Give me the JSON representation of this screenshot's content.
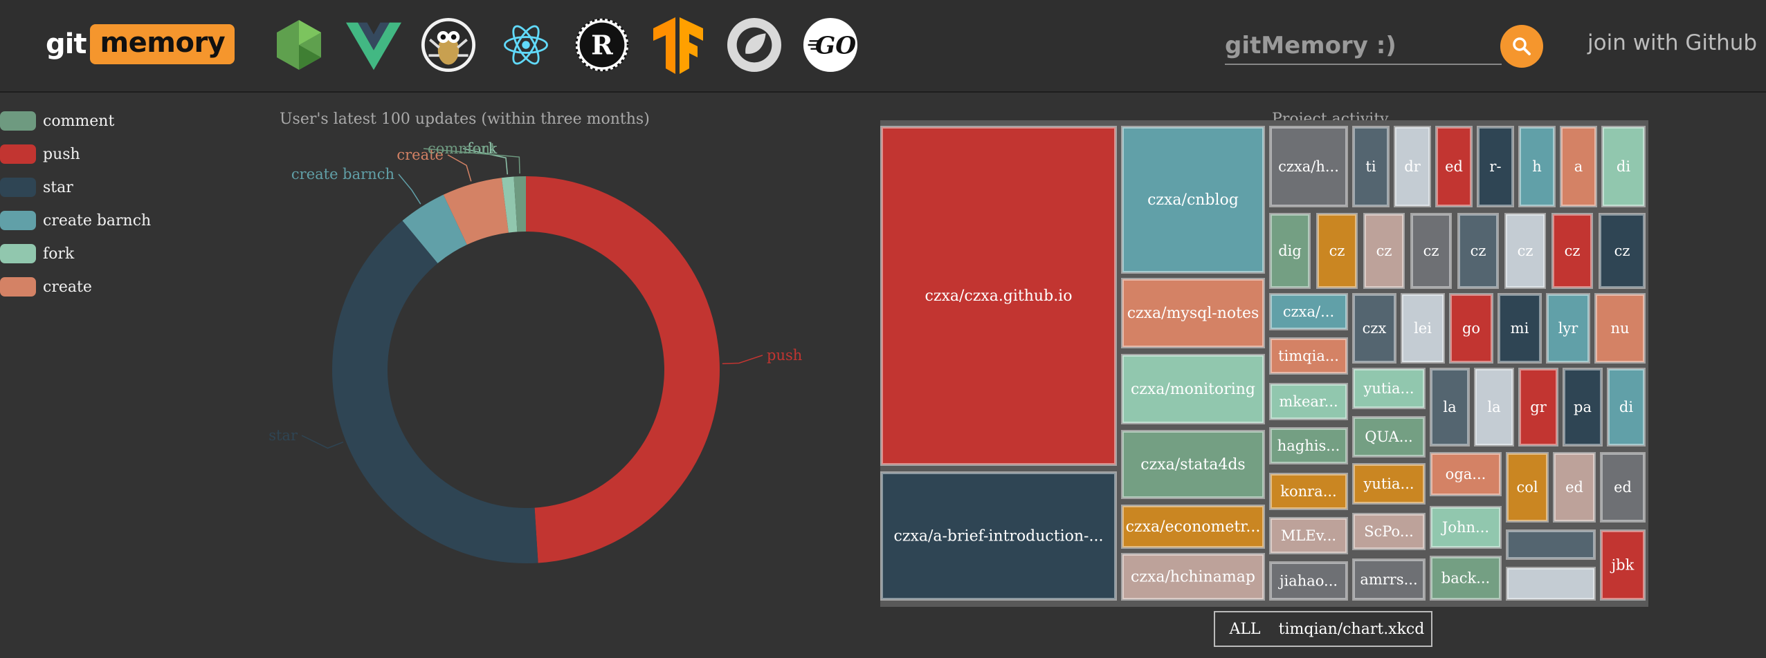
{
  "header": {
    "logo": {
      "part1": "git",
      "part2": "memory"
    },
    "tech_icons": [
      {
        "name": "nodejs-icon",
        "color": "#5fa04e"
      },
      {
        "name": "vue-icon",
        "color": "#42b883"
      },
      {
        "name": "scrapy-spider-icon",
        "color": "#c8a050"
      },
      {
        "name": "react-icon",
        "color": "#61dafb"
      },
      {
        "name": "rust-icon",
        "color": "#111111"
      },
      {
        "name": "tensorflow-icon",
        "color": "#ff8f00"
      },
      {
        "name": "spring-icon",
        "color": "#dddddd"
      },
      {
        "name": "golang-icon",
        "text": "GO"
      }
    ],
    "search": {
      "placeholder": "gitMemory :)"
    },
    "search_icon": "search-icon",
    "join_label": "join with Github"
  },
  "legend": [
    {
      "label": "comment",
      "color": "#6e9a80"
    },
    {
      "label": "push",
      "color": "#c23531"
    },
    {
      "label": "star",
      "color": "#2f4554"
    },
    {
      "label": "create barnch",
      "color": "#61a0a8"
    },
    {
      "label": "fork",
      "color": "#91c7ae"
    },
    {
      "label": "create",
      "color": "#d48265"
    }
  ],
  "chart_data": [
    {
      "type": "pie",
      "title": "User's latest 100 updates (within three months)",
      "slices": [
        {
          "name": "push",
          "value": 49,
          "color": "#c23531"
        },
        {
          "name": "star",
          "value": 40,
          "color": "#2f4554"
        },
        {
          "name": "create barnch",
          "value": 4,
          "color": "#61a0a8"
        },
        {
          "name": "create",
          "value": 5,
          "color": "#d48265"
        },
        {
          "name": "fork",
          "value": 1,
          "color": "#91c7ae"
        },
        {
          "name": "comment",
          "value": 1,
          "color": "#6e9a80"
        }
      ],
      "callouts": [
        {
          "name": "push",
          "label": "push"
        },
        {
          "name": "star",
          "label": "star"
        },
        {
          "name": "create barnch",
          "label": "create barnch"
        },
        {
          "name": "create",
          "label": "create"
        },
        {
          "name": "fork",
          "label": "fork"
        },
        {
          "name": "comment",
          "label": "comment"
        }
      ]
    },
    {
      "type": "treemap",
      "title": "Project activity",
      "nodes": [
        {
          "label": "czxa/czxa.github.io",
          "color": "#c23531"
        },
        {
          "label": "czxa/a-brief-introduction-...",
          "color": "#2f4554"
        },
        {
          "label": "czxa/cnblog",
          "color": "#61a0a8"
        },
        {
          "label": "czxa/mysql-notes",
          "color": "#d48265"
        },
        {
          "label": "czxa/monitoring",
          "color": "#91c7ae"
        },
        {
          "label": "czxa/stata4ds",
          "color": "#749f83"
        },
        {
          "label": "czxa/econometr...",
          "color": "#ca8622"
        },
        {
          "label": "czxa/hchinamap",
          "color": "#bda29a"
        },
        {
          "label": "czxa/h...",
          "color": "#6e7074"
        },
        {
          "label": "ti",
          "color": "#546570"
        },
        {
          "label": "dr",
          "color": "#c4ccd3"
        },
        {
          "label": "ed",
          "color": "#c23531"
        },
        {
          "label": "r-",
          "color": "#2f4554"
        },
        {
          "label": "h",
          "color": "#61a0a8"
        },
        {
          "label": "a",
          "color": "#d48265"
        },
        {
          "label": "di",
          "color": "#91c7ae"
        },
        {
          "label": "dig",
          "color": "#749f83"
        },
        {
          "label": "cz",
          "color": "#ca8622"
        },
        {
          "label": "cz",
          "color": "#bda29a"
        },
        {
          "label": "cz",
          "color": "#6e7074"
        },
        {
          "label": "cz",
          "color": "#546570"
        },
        {
          "label": "cz",
          "color": "#c4ccd3"
        },
        {
          "label": "cz",
          "color": "#c23531"
        },
        {
          "label": "cz",
          "color": "#2f4554"
        },
        {
          "label": "czxa/...",
          "color": "#61a0a8"
        },
        {
          "label": "timqia...",
          "color": "#d48265"
        },
        {
          "label": "mkear...",
          "color": "#91c7ae"
        },
        {
          "label": "haghis...",
          "color": "#749f83"
        },
        {
          "label": "konra...",
          "color": "#ca8622"
        },
        {
          "label": "MLEv...",
          "color": "#bda29a"
        },
        {
          "label": "jiahao...",
          "color": "#6e7074"
        },
        {
          "label": "czx",
          "color": "#546570"
        },
        {
          "label": "lei",
          "color": "#c4ccd3"
        },
        {
          "label": "go",
          "color": "#c23531"
        },
        {
          "label": "mi",
          "color": "#2f4554"
        },
        {
          "label": "lyr",
          "color": "#61a0a8"
        },
        {
          "label": "nu",
          "color": "#d48265"
        },
        {
          "label": "yutia...",
          "color": "#91c7ae"
        },
        {
          "label": "QUA...",
          "color": "#749f83"
        },
        {
          "label": "yutia...",
          "color": "#ca8622"
        },
        {
          "label": "ScPo...",
          "color": "#bda29a"
        },
        {
          "label": "amrrs...",
          "color": "#6e7074"
        },
        {
          "label": "la",
          "color": "#546570"
        },
        {
          "label": "la",
          "color": "#c4ccd3"
        },
        {
          "label": "gr",
          "color": "#c23531"
        },
        {
          "label": "pa",
          "color": "#2f4554"
        },
        {
          "label": "di",
          "color": "#61a0a8"
        },
        {
          "label": "oga...",
          "color": "#d48265"
        },
        {
          "label": "John...",
          "color": "#91c7ae"
        },
        {
          "label": "back...",
          "color": "#749f83"
        },
        {
          "label": "col",
          "color": "#ca8622"
        },
        {
          "label": "ed",
          "color": "#bda29a"
        },
        {
          "label": "ed",
          "color": "#6e7074"
        },
        {
          "label": "",
          "color": "#546570"
        },
        {
          "label": "",
          "color": "#c4ccd3"
        },
        {
          "label": "jbk",
          "color": "#c23531"
        }
      ],
      "breadcrumb": [
        "ALL",
        "timqian/chart.xkcd"
      ]
    }
  ]
}
